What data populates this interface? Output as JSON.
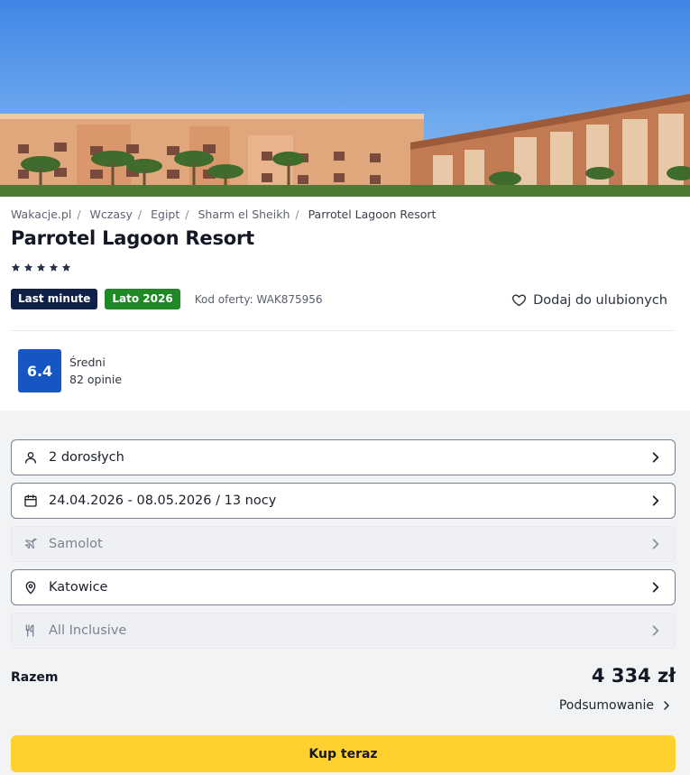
{
  "hero": {
    "image": "hotel-facade-with-palm-trees"
  },
  "breadcrumb": [
    "Wakacje.pl",
    "Wczasy",
    "Egipt",
    "Sharm el Sheikh",
    "Parrotel Lagoon Resort"
  ],
  "hotel": {
    "name": "Parrotel Lagoon Resort",
    "stars": 5,
    "badges": {
      "last_minute": "Last minute",
      "season": "Lato 2026"
    },
    "offer_code": "Kod oferty: WAK875956",
    "favorite_label": "Dodaj do ulubionych",
    "rating": {
      "score": "6.4",
      "label": "Średni",
      "reviews": "82 opinie"
    }
  },
  "booking": {
    "travelers": "2 dorosłych",
    "dates": "24.04.2026 - 08.05.2026 / 13 nocy",
    "transport": "Samolot",
    "departure": "Katowice",
    "board": "All Inclusive"
  },
  "summary": {
    "total_label": "Razem",
    "total_price": "4 334 zł",
    "summary_link": "Podsumowanie",
    "buy_button": "Kup teraz"
  },
  "colors": {
    "badge_last_minute": "#0f2149",
    "badge_season": "#1f8a25",
    "rating_score": "#1656c3",
    "buy_button": "#ffd12e"
  },
  "icons": {
    "travelers": "person-icon",
    "dates": "calendar-icon",
    "transport": "plane-icon",
    "departure": "location-pin-icon",
    "board": "cutlery-icon",
    "favorite": "heart-icon",
    "chevron": "chevron-right-icon"
  }
}
